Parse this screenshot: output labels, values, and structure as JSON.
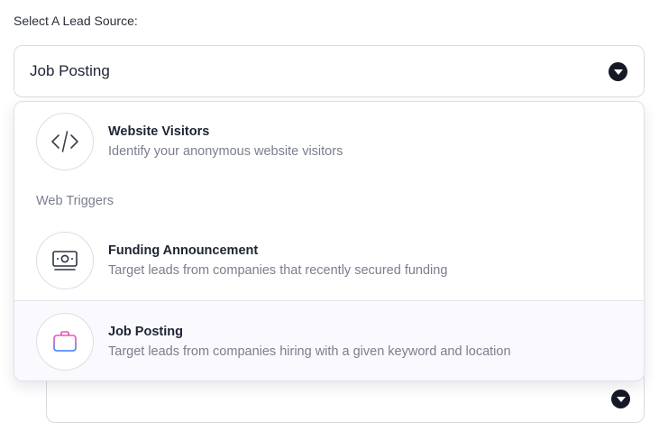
{
  "form": {
    "label": "Select A Lead Source:",
    "selected_value": "Job Posting"
  },
  "dropdown": {
    "options": [
      {
        "title": "Website Visitors",
        "description": "Identify your anonymous website visitors",
        "icon": "code-icon"
      },
      {
        "title": "Funding Announcement",
        "description": "Target leads from companies that recently secured funding",
        "icon": "money-icon"
      },
      {
        "title": "Job Posting",
        "description": "Target leads from companies hiring with a given keyword and location",
        "icon": "briefcase-icon",
        "selected": true
      }
    ],
    "group_label": "Web Triggers"
  },
  "colors": {
    "chevron_bg": "#151925",
    "selected_bg": "#faf9fd",
    "briefcase_gradient_start": "#ff4fa3",
    "briefcase_gradient_end": "#3d7bff"
  }
}
